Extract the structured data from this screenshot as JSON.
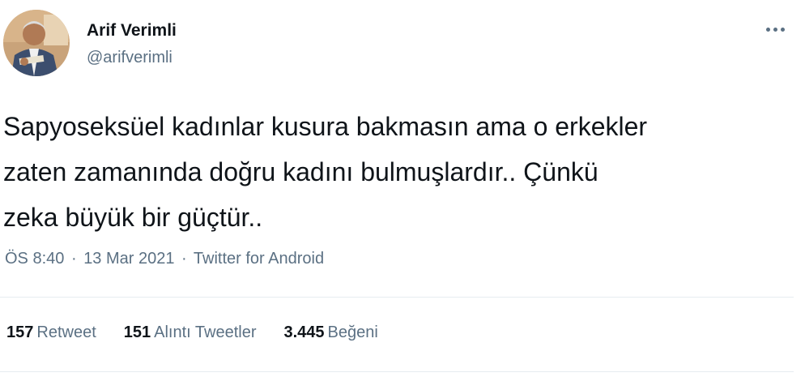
{
  "author": {
    "name": "Arif Verimli",
    "handle": "@arifverimli",
    "avatar_icon": "profile-photo"
  },
  "tweet": {
    "text_lines": [
      "Sapyoseksüel kadınlar kusura bakmasın ama o erkekler",
      "zaten zamanında doğru kadını bulmuşlardır.. Çünkü",
      "zeka büyük bir güçtür.."
    ],
    "time": "ÖS 8:40",
    "separator": "·",
    "date": "13 Mar 2021",
    "source": "Twitter for Android"
  },
  "stats": {
    "retweets": {
      "count": "157",
      "label": "Retweet"
    },
    "quotes": {
      "count": "151",
      "label": "Alıntı Tweetler"
    },
    "likes": {
      "count": "3.445",
      "label": "Beğeni"
    }
  },
  "colors": {
    "text": "#0f1419",
    "secondary": "#5b7083",
    "divider": "#e6ecf0"
  },
  "icons": {
    "more": "more-horizontal-icon"
  }
}
